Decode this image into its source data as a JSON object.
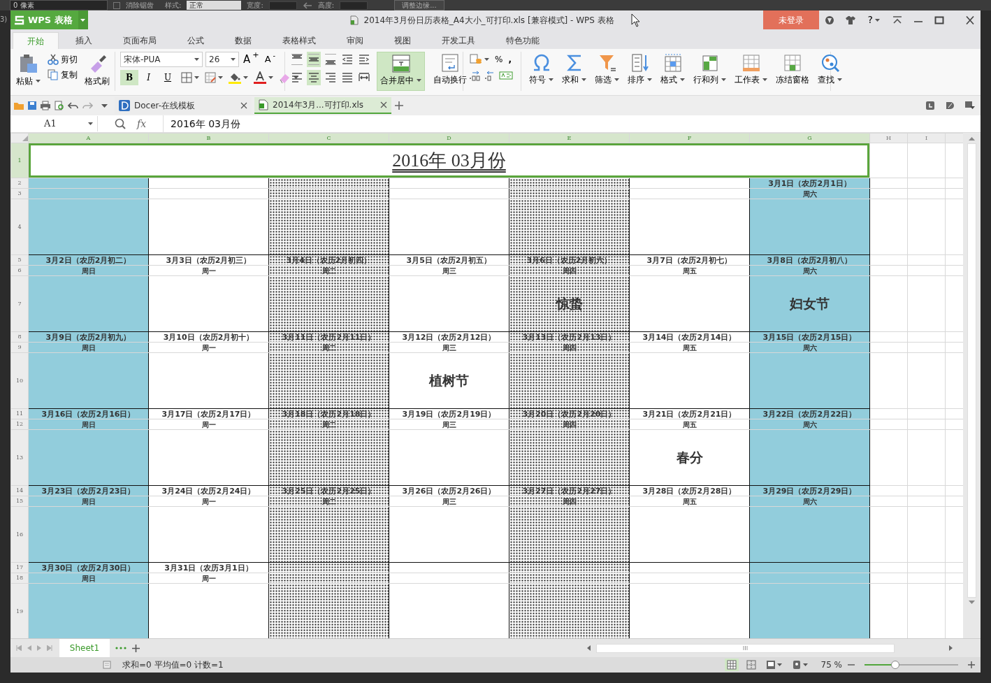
{
  "background_app": {
    "pixel_field": "0 像素",
    "anti_alias": {
      "label": "消除锯齿",
      "checked": false
    },
    "style_label": "样式:",
    "style_select": "正常",
    "width_label": "宽度:",
    "height_label": "高度:",
    "refine_button": "调整边缘...",
    "edge_text": "3)"
  },
  "window": {
    "app_menu": "WPS 表格",
    "title": "2014年3月份日历表格_A4大小_可打印.xls [兼容模式] - WPS 表格",
    "login_button": "未登录",
    "help": "?"
  },
  "ribbon_tabs": [
    {
      "label": "开始",
      "selected": true
    },
    {
      "label": "插入",
      "selected": false
    },
    {
      "label": "页面布局",
      "selected": false
    },
    {
      "label": "公式",
      "selected": false
    },
    {
      "label": "数据",
      "selected": false
    },
    {
      "label": "表格样式",
      "selected": false
    },
    {
      "label": "审阅",
      "selected": false
    },
    {
      "label": "视图",
      "selected": false
    },
    {
      "label": "开发工具",
      "selected": false
    },
    {
      "label": "特色功能",
      "selected": false
    }
  ],
  "ribbon": {
    "clipboard": {
      "paste": "粘贴",
      "cut": "剪切",
      "copy": "复制",
      "format_painter": "格式刷"
    },
    "font": {
      "name": "宋体-PUA",
      "size": "26",
      "grow": "A$^{+}$",
      "shrink": "A$^{-}$",
      "styles": [
        {
          "label": "B",
          "kind": "bold",
          "selected": true
        },
        {
          "label": "I",
          "kind": "italic",
          "selected": false
        },
        {
          "label": "U",
          "kind": "underline",
          "selected": false
        }
      ]
    },
    "alignment": {
      "vertical": [
        {
          "kind": "top",
          "selected": false
        },
        {
          "kind": "middle",
          "selected": true
        },
        {
          "kind": "bottom",
          "selected": false
        }
      ],
      "horizontal": [
        {
          "kind": "left",
          "selected": false
        },
        {
          "kind": "center",
          "selected": true
        },
        {
          "kind": "right",
          "selected": false
        },
        {
          "kind": "justify",
          "selected": false
        }
      ],
      "merge": {
        "label": "合并居中",
        "selected": true
      },
      "wrap": "自动换行"
    },
    "number": {
      "percent": "%",
      "comma": ","
    },
    "tools": [
      {
        "label": "符号",
        "kind": "symbol",
        "dropdown": true
      },
      {
        "label": "求和",
        "kind": "sum",
        "dropdown": true
      },
      {
        "label": "筛选",
        "kind": "filter",
        "dropdown": true
      },
      {
        "label": "排序",
        "kind": "sort",
        "dropdown": true
      },
      {
        "label": "格式",
        "kind": "format",
        "dropdown": true
      },
      {
        "label": "行和列",
        "kind": "rows_columns",
        "dropdown": true
      },
      {
        "label": "工作表",
        "kind": "worksheet",
        "dropdown": true
      },
      {
        "label": "冻结窗格",
        "kind": "freeze",
        "dropdown": false
      },
      {
        "label": "查找",
        "kind": "find",
        "dropdown": true
      }
    ]
  },
  "document_tabs": [
    {
      "label": "Docer-在线模板",
      "kind": "docer",
      "selected": false
    },
    {
      "label": "2014年3月...可打印.xls",
      "kind": "sheet",
      "selected": true
    }
  ],
  "formula_bar": {
    "name_box": "A1",
    "fx": "fx",
    "content": "2016年  03月份"
  },
  "sheet": {
    "columns": [
      {
        "label": "A",
        "kind": "weekend",
        "selected": true
      },
      {
        "label": "B",
        "kind": "plain",
        "selected": true
      },
      {
        "label": "C",
        "kind": "dotted",
        "selected": true
      },
      {
        "label": "D",
        "kind": "plain",
        "selected": true
      },
      {
        "label": "E",
        "kind": "dotted",
        "selected": true
      },
      {
        "label": "F",
        "kind": "plain",
        "selected": true
      },
      {
        "label": "G",
        "kind": "weekend",
        "selected": true
      },
      {
        "label": "H",
        "kind": "blank",
        "selected": false
      },
      {
        "label": "I",
        "kind": "blank",
        "selected": false
      }
    ],
    "row_headers": [
      {
        "label": "1",
        "selected": true
      },
      {
        "label": "2",
        "selected": false
      },
      {
        "label": "3",
        "selected": false
      },
      {
        "label": "4",
        "selected": false
      },
      {
        "label": "5",
        "selected": false
      },
      {
        "label": "6",
        "selected": false
      },
      {
        "label": "7",
        "selected": false
      },
      {
        "label": "8",
        "selected": false
      },
      {
        "label": "9",
        "selected": false
      },
      {
        "label": "10",
        "selected": false
      },
      {
        "label": "11",
        "selected": false
      },
      {
        "label": "12",
        "selected": false
      },
      {
        "label": "13",
        "selected": false
      },
      {
        "label": "14",
        "selected": false
      },
      {
        "label": "15",
        "selected": false
      },
      {
        "label": "16",
        "selected": false
      },
      {
        "label": "17",
        "selected": false
      },
      {
        "label": "18",
        "selected": false
      },
      {
        "label": "19",
        "selected": false
      }
    ],
    "title": {
      "text": "2016年  03月份",
      "selected": true
    },
    "weeks": [
      [
        {
          "kind": "empty"
        },
        {
          "kind": "empty"
        },
        {
          "kind": "empty"
        },
        {
          "kind": "empty"
        },
        {
          "kind": "empty"
        },
        {
          "kind": "empty"
        },
        {
          "kind": "day",
          "date": "3月1日（农历2月1日）",
          "weekday": "周六"
        }
      ],
      [
        {
          "date": "3月2日（农历2月初二）",
          "weekday": "周日"
        },
        {
          "date": "3月3日（农历2月初三）",
          "weekday": "周一"
        },
        {
          "date": "3月4日（农历2月初四）",
          "weekday": "周二"
        },
        {
          "date": "3月5日（农历2月初五）",
          "weekday": "周三"
        },
        {
          "date": "3月6日（农历2月初六）",
          "weekday": "周四",
          "note": "惊蛰"
        },
        {
          "date": "3月7日（农历2月初七）",
          "weekday": "周五"
        },
        {
          "date": "3月8日（农历2月初八）",
          "weekday": "周六",
          "note": "妇女节"
        }
      ],
      [
        {
          "date": "3月9日（农历2月初九）",
          "weekday": "周日"
        },
        {
          "date": "3月10日（农历2月初十）",
          "weekday": "周一"
        },
        {
          "date": "3月11日（农历2月11日）",
          "weekday": "周二"
        },
        {
          "date": "3月12日（农历2月12日）",
          "weekday": "周三",
          "note": "植树节"
        },
        {
          "date": "3月13日（农历2月13日）",
          "weekday": "周四"
        },
        {
          "date": "3月14日（农历2月14日）",
          "weekday": "周五"
        },
        {
          "date": "3月15日（农历2月15日）",
          "weekday": "周六"
        }
      ],
      [
        {
          "date": "3月16日（农历2月16日）",
          "weekday": "周日"
        },
        {
          "date": "3月17日（农历2月17日）",
          "weekday": "周一"
        },
        {
          "date": "3月18日（农历2月18日）",
          "weekday": "周二"
        },
        {
          "date": "3月19日（农历2月19日）",
          "weekday": "周三"
        },
        {
          "date": "3月20日（农历2月20日）",
          "weekday": "周四"
        },
        {
          "date": "3月21日（农历2月21日）",
          "weekday": "周五",
          "note": "春分"
        },
        {
          "date": "3月22日（农历2月22日）",
          "weekday": "周六"
        }
      ],
      [
        {
          "date": "3月23日（农历2月23日）",
          "weekday": "周日"
        },
        {
          "date": "3月24日（农历2月24日）",
          "weekday": "周一"
        },
        {
          "date": "3月25日（农历2月25日）",
          "weekday": "周二"
        },
        {
          "date": "3月26日（农历2月26日）",
          "weekday": "周三"
        },
        {
          "date": "3月27日（农历2月27日）",
          "weekday": "周四"
        },
        {
          "date": "3月28日（农历2月28日）",
          "weekday": "周五"
        },
        {
          "date": "3月29日（农历2月29日）",
          "weekday": "周六"
        }
      ],
      [
        {
          "date": "3月30日（农历2月30日）",
          "weekday": "周日"
        },
        {
          "date": "3月31日（农历3月1日）",
          "weekday": "周一"
        },
        {
          "kind": "empty"
        },
        {
          "kind": "empty"
        },
        {
          "kind": "empty"
        },
        {
          "kind": "empty"
        },
        {
          "kind": "empty"
        }
      ]
    ]
  },
  "sheet_tabs": [
    {
      "label": "Sheet1",
      "selected": true
    }
  ],
  "status_bar": {
    "summary": "求和=0 平均值=0 计数=1",
    "views": [
      {
        "kind": "normal",
        "selected": true
      },
      {
        "kind": "page_break",
        "selected": false
      },
      {
        "kind": "reading",
        "selected": false
      },
      {
        "kind": "eye_care",
        "selected": false
      }
    ],
    "zoom": "75 %",
    "zoom_slider": {
      "level": 0.33
    }
  }
}
